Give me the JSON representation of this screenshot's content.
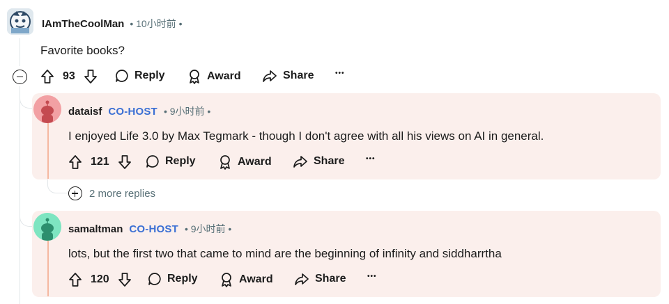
{
  "colors": {
    "accent": "#3a6fd4",
    "card_bg": "#fbefec",
    "thread_line": "#e2e6e9",
    "text_muted": "#576f76"
  },
  "top_comment": {
    "username": "IAmTheCoolMan",
    "meta": "• 10小时前 •",
    "body": "Favorite books?",
    "score": "93",
    "reply_label": "Reply",
    "award_label": "Award",
    "share_label": "Share",
    "more_label": "•••",
    "collapse_icon": "collapse-icon"
  },
  "replies": [
    {
      "username": "dataisf",
      "badge": "CO-HOST",
      "meta": "• 9小时前 •",
      "body": "I enjoyed Life 3.0 by Max Tegmark - though I don't agree with all his views on AI in general.",
      "score": "121",
      "reply_label": "Reply",
      "award_label": "Award",
      "share_label": "Share",
      "more_label": "•••",
      "avatar_color": "#f2a0a3",
      "more_replies": "2 more replies"
    },
    {
      "username": "samaltman",
      "badge": "CO-HOST",
      "meta": "• 9小时前 •",
      "body": "lots, but the first two that came to mind are the beginning of infinity and siddharrtha",
      "score": "120",
      "reply_label": "Reply",
      "award_label": "Award",
      "share_label": "Share",
      "more_label": "•••",
      "avatar_color": "#7ee5c1"
    }
  ]
}
